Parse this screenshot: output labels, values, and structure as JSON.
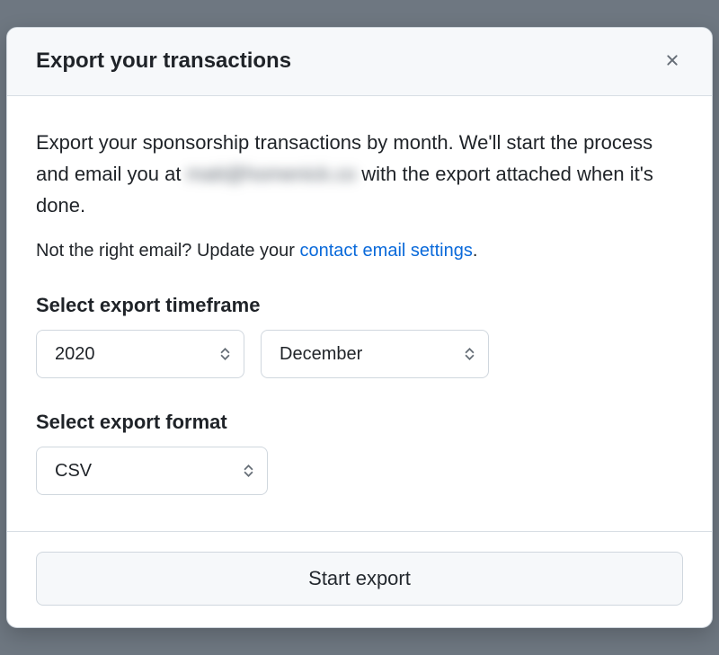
{
  "modal": {
    "title": "Export your transactions",
    "description_prefix": "Export your sponsorship transactions by month. We'll start the process and email you at ",
    "email_masked": "matt@homenick.co",
    "description_suffix": " with the export attached when it's done.",
    "email_note_prefix": "Not the right email? Update your ",
    "email_note_link": "contact email settings",
    "email_note_suffix": ".",
    "timeframe_label": "Select export timeframe",
    "year_value": "2020",
    "month_value": "December",
    "format_label": "Select export format",
    "format_value": "CSV",
    "start_button": "Start export"
  }
}
